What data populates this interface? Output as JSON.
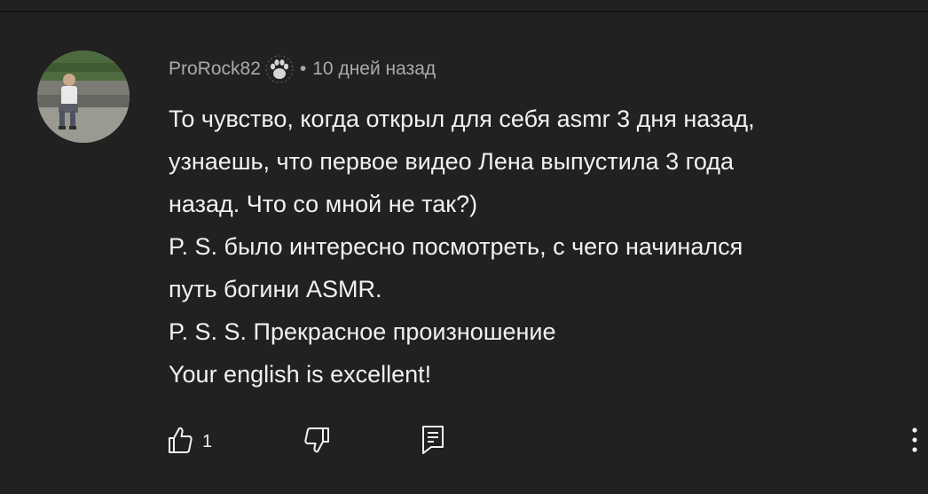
{
  "comment": {
    "author": "ProRock82",
    "badge_icon": "paw-icon",
    "separator": "•",
    "time_ago": "10 дней назад",
    "text_lines": [
      "То чувство, когда открыл для себя asmr 3 дня назад,",
      "узнаешь, что первое видео Лена выпустила 3 года",
      "назад. Что со мной не так?)",
      "P. S. было интересно посмотреть, с чего начинался",
      "путь богини ASMR.",
      "P. S. S. Прекрасное произношение",
      "Your english is excellent!"
    ],
    "like_count": "1"
  },
  "actions": {
    "like_icon": "thumbs-up-icon",
    "dislike_icon": "thumbs-down-icon",
    "reply_icon": "reply-icon",
    "more_icon": "more-vert-icon"
  },
  "colors": {
    "background": "#212121",
    "text_primary": "#f1f1f1",
    "text_secondary": "#aaaaaa"
  }
}
